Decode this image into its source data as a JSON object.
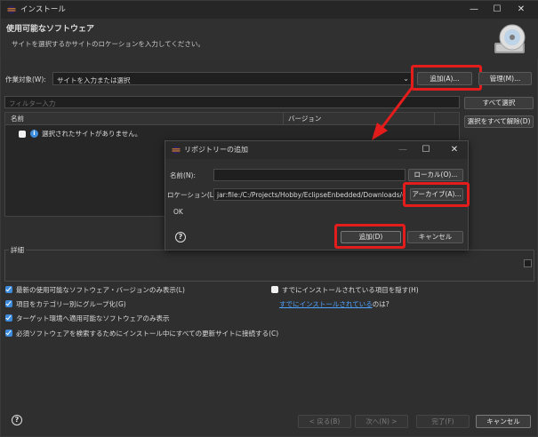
{
  "window": {
    "title": "インストール",
    "minimize_icon": "minimize-icon",
    "maximize_icon": "maximize-icon",
    "close_icon": "close-icon"
  },
  "header": {
    "title": "使用可能なソフトウェア",
    "subtitle": "サイトを選択するかサイトのロケーションを入力してください。"
  },
  "work_with": {
    "label": "作業対象(W):",
    "placeholder": "サイトを入力または選択",
    "add_button": "追加(A)...",
    "manage_button": "管理(M)..."
  },
  "filter": {
    "placeholder": "フィルター入力",
    "select_all_button": "すべて選択",
    "deselect_all_button": "選択をすべて解除(D)"
  },
  "table": {
    "columns": [
      "名前",
      "バージョン"
    ],
    "rows": [
      {
        "text": "選択されたサイトがありません。",
        "checked": false
      }
    ]
  },
  "details": {
    "label": "詳細"
  },
  "options": {
    "left": [
      {
        "label": "最新の使用可能なソフトウェア・バージョンのみ表示(L)",
        "checked": true
      },
      {
        "label": "項目をカテゴリー別にグループ化(G)",
        "checked": true
      },
      {
        "label": "ターゲット環境へ適用可能なソフトウェアのみ表示",
        "checked": true
      },
      {
        "label": "必須ソフトウェアを検索するためにインストール中にすべての更新サイトに接続する(C)",
        "checked": true
      }
    ],
    "right": {
      "hide_installed": {
        "label": "すでにインストールされている項目を隠す(H)",
        "checked": false
      },
      "what_is_installed_link": "すでにインストールされている",
      "what_is_installed_suffix": "のは?"
    }
  },
  "footer": {
    "back_button": "< 戻る(B)",
    "next_button": "次へ(N) >",
    "finish_button": "完了(F)",
    "cancel_button": "キャンセル"
  },
  "dialog": {
    "title": "リポジトリーの追加",
    "name_label": "名前(N):",
    "name_value": "",
    "local_button": "ローカル(O)...",
    "location_label": "ロケーション(L):",
    "location_value": "jar:file:/C:/Projects/Hobby/EclipseEnbedded/Downloads/(",
    "archive_button": "アーカイブ(A)...",
    "status_text": "OK",
    "add_button": "追加(D)",
    "cancel_button": "キャンセル"
  },
  "colors": {
    "highlight": "#e51c1c",
    "checkbox": "#3d8bdc",
    "link": "#4ea3ff"
  }
}
